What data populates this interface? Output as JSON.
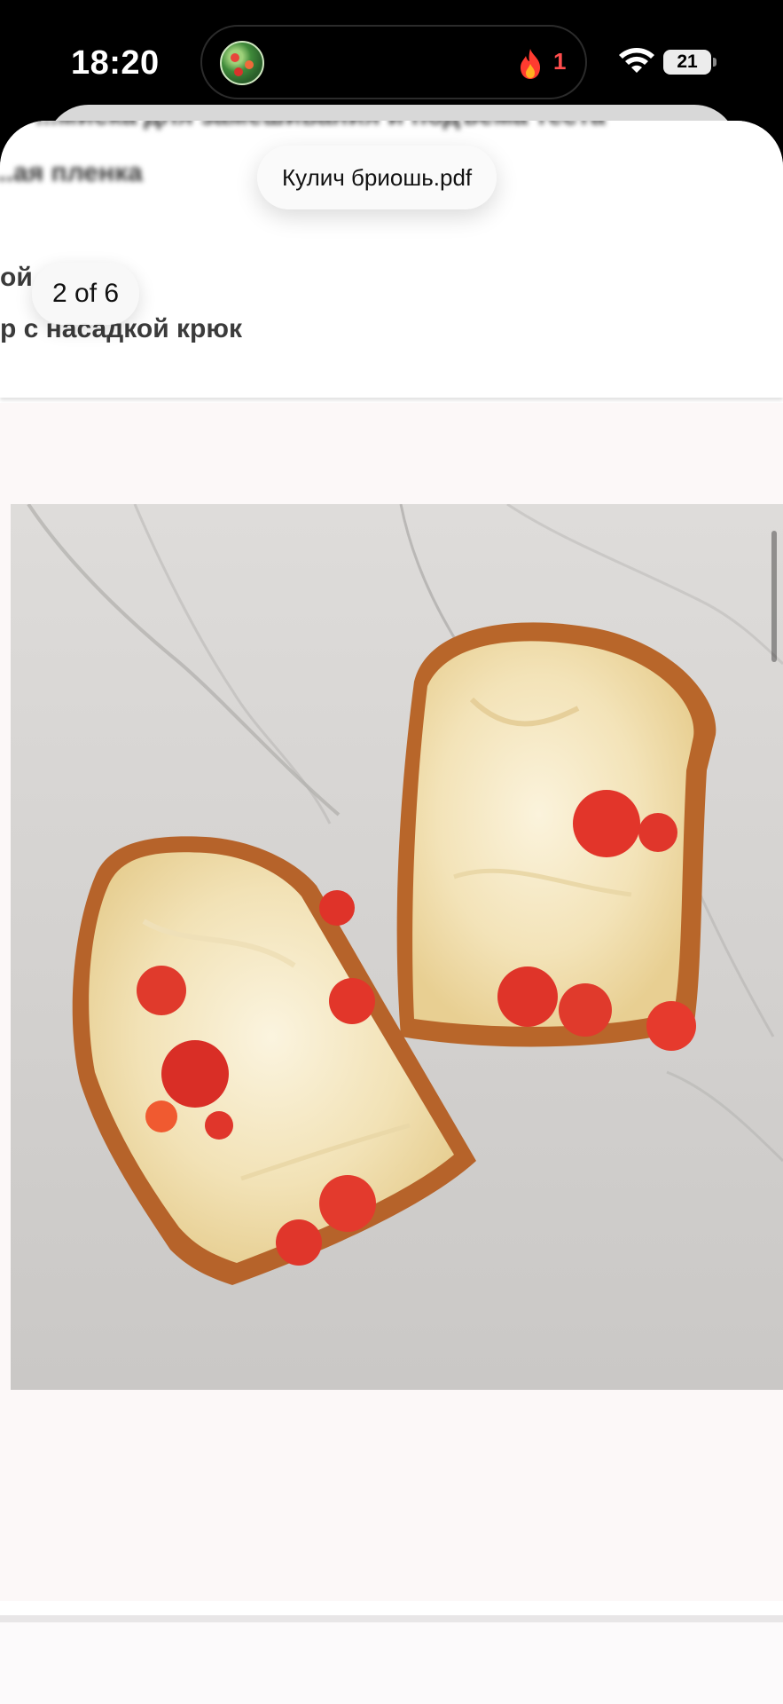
{
  "status_bar": {
    "time": "18:20",
    "notification_count": "1",
    "battery_level": "21",
    "icons": [
      "app-avatar-icon",
      "flame-icon",
      "wifi-icon",
      "battery-icon"
    ]
  },
  "viewer": {
    "file_title": "Кулич бриошь.pdf",
    "page_indicator": "2 of 6"
  },
  "document": {
    "blurred_line_1": "...миска для замешивания и подъема теста",
    "blurred_line_2": "...ая пленка",
    "partial_line_1": "ой",
    "partial_line_2": "р с насадкой крюк",
    "image_description_icon": "photo"
  },
  "colors": {
    "flame_accent": "#ff4d4d",
    "page_background": "#fcf8f8"
  }
}
